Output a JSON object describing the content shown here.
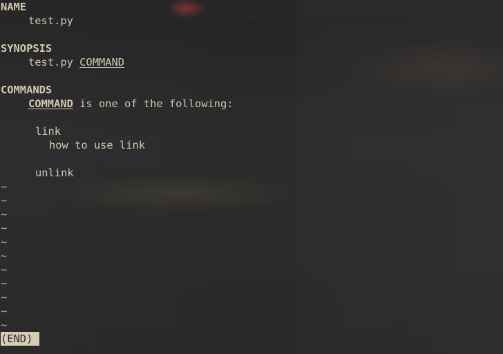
{
  "sections": {
    "name_heading": "NAME",
    "name_value": "test.py",
    "synopsis_heading": "SYNOPSIS",
    "synopsis_prog": "test.py",
    "synopsis_arg": "COMMAND",
    "commands_heading": "COMMANDS",
    "commands_arg": "COMMAND",
    "commands_intro": " is one of the following:",
    "commands": [
      {
        "name": "link",
        "description": "how to use link"
      },
      {
        "name": "unlink",
        "description": ""
      }
    ]
  },
  "tilde_char": "~",
  "status_text": "(END)"
}
